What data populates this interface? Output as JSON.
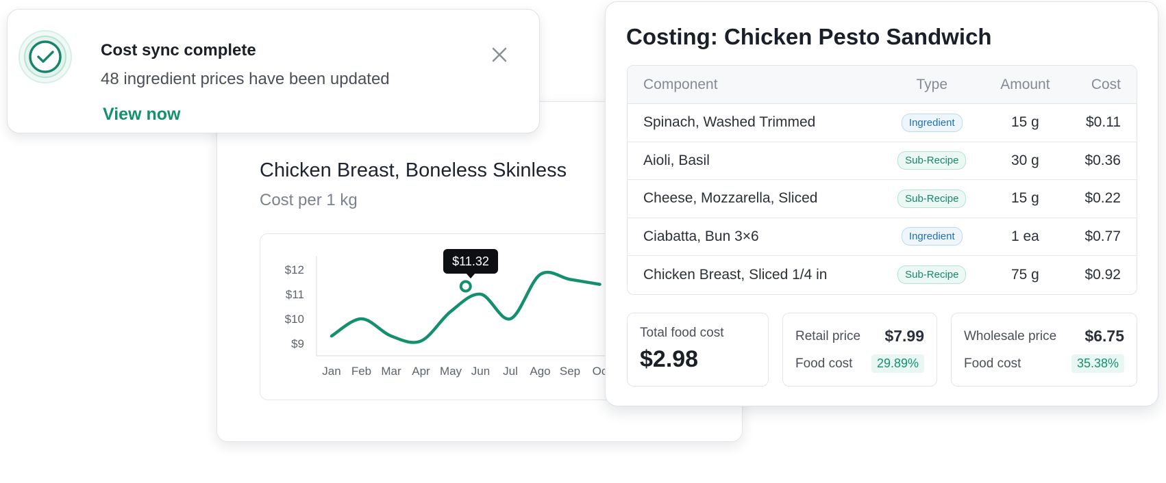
{
  "toast": {
    "title": "Cost sync complete",
    "message": "48 ingredient prices have been updated",
    "link": "View now"
  },
  "price_chart": {
    "item_name": "Chicken Breast, Boneless Skinless",
    "subtitle": "Cost per 1 kg",
    "tooltip": "$11.32",
    "colors": {
      "line": "#14906f",
      "tooltip_bg": "#0d0f12"
    }
  },
  "chart_data": {
    "type": "line",
    "categories": [
      "Jan",
      "Feb",
      "Mar",
      "Apr",
      "May",
      "Jun",
      "Jul",
      "Ago",
      "Sep",
      "Oc"
    ],
    "values": [
      9.3,
      10.0,
      9.3,
      9.1,
      10.3,
      11.0,
      10.0,
      11.8,
      11.6,
      11.4
    ],
    "y_ticks": [
      "$12",
      "$11",
      "$10",
      "$9"
    ],
    "ylim": [
      9,
      12
    ],
    "highlight": {
      "category": "May-Jun",
      "value": 11.32,
      "label": "$11.32"
    },
    "grid": false
  },
  "costing": {
    "title": "Costing: Chicken Pesto Sandwich",
    "columns": {
      "component": "Component",
      "type": "Type",
      "amount": "Amount",
      "cost": "Cost"
    },
    "rows": [
      {
        "component": "Spinach, Washed Trimmed",
        "type": "Ingredient",
        "amount": "15 g",
        "cost": "$0.11"
      },
      {
        "component": "Aioli, Basil",
        "type": "Sub-Recipe",
        "amount": "30 g",
        "cost": "$0.36"
      },
      {
        "component": "Cheese, Mozzarella, Sliced",
        "type": "Sub-Recipe",
        "amount": "15 g",
        "cost": "$0.22"
      },
      {
        "component": "Ciabatta, Bun 3×6",
        "type": "Ingredient",
        "amount": "1 ea",
        "cost": "$0.77"
      },
      {
        "component": "Chicken Breast, Sliced 1/4 in",
        "type": "Sub-Recipe",
        "amount": "75 g",
        "cost": "$0.92"
      }
    ],
    "total": {
      "label": "Total food cost",
      "value": "$2.98"
    },
    "retail": {
      "label": "Retail price",
      "price": "$7.99",
      "fc_label": "Food cost",
      "fc_value": "29.89%"
    },
    "wholesale": {
      "label": "Wholesale price",
      "price": "$6.75",
      "fc_label": "Food cost",
      "fc_value": "35.38%"
    }
  }
}
